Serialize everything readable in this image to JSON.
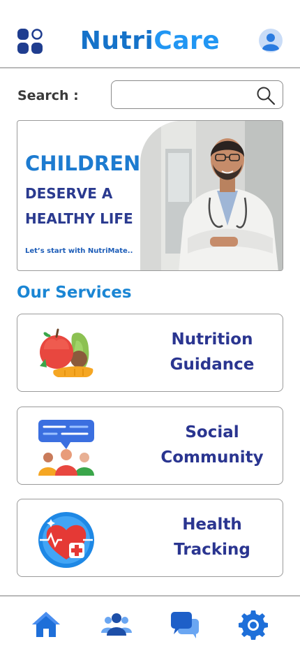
{
  "app": {
    "logo_part1": "Nutri",
    "logo_part2": "Care"
  },
  "search": {
    "label": "Search :",
    "placeholder": "",
    "value": ""
  },
  "banner": {
    "headline": "CHILDREN",
    "subline": "DESERVE A HEALTHY LIFE",
    "cta": "Let’s start with NutriMate.."
  },
  "services": {
    "title": "Our Services",
    "items": [
      {
        "label": "Nutrition Guidance",
        "icon": "fruit-vegetable-icon"
      },
      {
        "label": "Social Community",
        "icon": "community-chat-icon"
      },
      {
        "label": "Health Tracking",
        "icon": "heart-health-icon"
      }
    ]
  },
  "nav": {
    "items": [
      {
        "icon": "home-icon"
      },
      {
        "icon": "users-icon"
      },
      {
        "icon": "chat-icon"
      },
      {
        "icon": "settings-icon"
      }
    ]
  },
  "colors": {
    "brand_blue": "#1b86d4",
    "navy": "#2a3590",
    "nav_blue": "#1e6fd9"
  }
}
